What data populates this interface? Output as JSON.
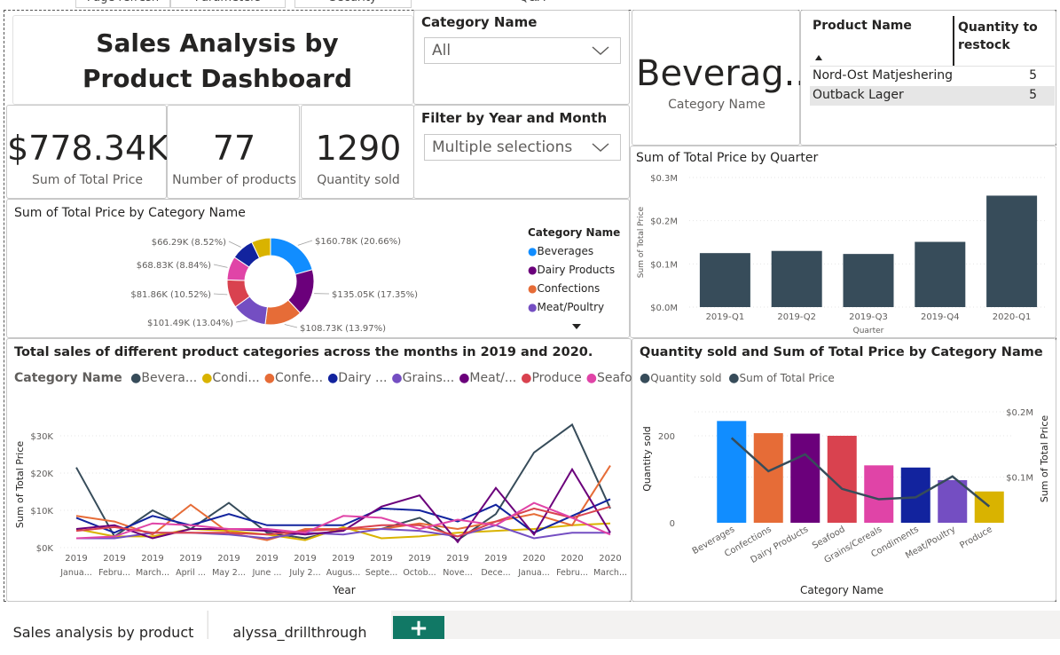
{
  "top_tabs": [
    "Page refresh",
    "Parameters",
    "Security",
    "Q&A"
  ],
  "title": "Sales Analysis by Product Dashboard",
  "cards": [
    {
      "value": "$778.34K",
      "label": "Sum of Total Price"
    },
    {
      "value": "77",
      "label": "Number of products"
    },
    {
      "value": "1290",
      "label": "Quantity sold"
    }
  ],
  "slicers": {
    "category": {
      "title": "Category Name",
      "value": "All"
    },
    "year_month": {
      "title": "Filter by Year and Month",
      "value": "Multiple selections"
    }
  },
  "category_card": {
    "value": "Beverag...",
    "label": "Category Name"
  },
  "restock_table": {
    "headers": [
      "Product Name",
      "Quantity to restock"
    ],
    "rows": [
      {
        "name": "Nord-Ost Matjeshering",
        "qty": "5"
      },
      {
        "name": "Outback Lager",
        "qty": "5"
      }
    ]
  },
  "quarter_chart": {
    "title": "Sum of Total Price by Quarter",
    "xlabel": "Quarter",
    "ylabel": "Sum of Total Price",
    "yticks": [
      "$0.0M",
      "$0.1M",
      "$0.2M",
      "$0.3M"
    ]
  },
  "donut_chart": {
    "title": "Sum of Total Price by Category Name",
    "legend_title": "Category Name",
    "legend": [
      "Beverages",
      "Dairy Products",
      "Confections",
      "Meat/Poultry"
    ],
    "labels": [
      "$160.78K (20.66%)",
      "$135.05K (17.35%)",
      "$108.73K (13.97%)",
      "$101.49K (13.04%)",
      "$81.86K (10.52%)",
      "$68.83K (8.84%)",
      "$66.29K (8.52%)"
    ]
  },
  "line_chart": {
    "title": "Total sales of different product categories across the months in 2019 and 2020.",
    "legend_title": "Category Name",
    "legend": [
      "Bevera...",
      "Condi...",
      "Confe...",
      "Dairy ...",
      "Grains...",
      "Meat/...",
      "Produce",
      "Seafood"
    ],
    "xlabel": "Year",
    "ylabel": "Sum of Total Price",
    "yticks": [
      "$0K",
      "$10K",
      "$20K",
      "$30K"
    ],
    "xticks_year": [
      "2019",
      "2019",
      "2019",
      "2019",
      "2019",
      "2019",
      "2019",
      "2019",
      "2019",
      "2019",
      "2019",
      "2019",
      "2020",
      "2020",
      "2020"
    ],
    "xticks_month": [
      "Janua...",
      "Febru...",
      "March...",
      "April ...",
      "May 2...",
      "June ...",
      "July 2...",
      "Augus...",
      "Septe...",
      "Octob...",
      "Nove...",
      "Dece...",
      "Janua...",
      "Febru...",
      "March..."
    ]
  },
  "combo_chart": {
    "title": "Quantity sold and Sum of Total Price by Category Name",
    "legend": [
      "Quantity sold",
      "Sum of Total Price"
    ],
    "xlabel": "Category Name",
    "ylabel_left": "Quantity sold",
    "ylabel_right": "Sum of Total Price",
    "yticks_left": [
      "0",
      "200"
    ],
    "yticks_right": [
      "$0.1M",
      "$0.2M"
    ]
  },
  "bottom_tabs": [
    "Sales analysis by product",
    "alyssa_drillthrough"
  ],
  "add_tab": "+",
  "chart_data": [
    {
      "type": "bar",
      "title": "Sum of Total Price by Quarter",
      "categories": [
        "2019-Q1",
        "2019-Q2",
        "2019-Q3",
        "2019-Q4",
        "2020-Q1"
      ],
      "values": [
        0.125,
        0.13,
        0.123,
        0.151,
        0.258
      ],
      "ylim": [
        0,
        0.3
      ],
      "color": "#374c5a",
      "xlabel": "Quarter",
      "ylabel": "Sum of Total Price"
    },
    {
      "type": "pie",
      "title": "Sum of Total Price by Category Name",
      "categories": [
        "Beverages",
        "Dairy Products",
        "Confections",
        "Meat/Poultry",
        "Seafood",
        "Condiments",
        "Grains/Cereals",
        "Produce"
      ],
      "values": [
        160.78,
        135.05,
        108.73,
        101.49,
        81.86,
        68.83,
        66.29,
        55.31
      ],
      "colors": [
        "#118dff",
        "#6b007b",
        "#e66c37",
        "#744ec2",
        "#d9424f",
        "#e044a7",
        "#12239e",
        "#d9b300"
      ]
    },
    {
      "type": "line",
      "title": "Total sales of different product categories across the months in 2019 and 2020.",
      "x": [
        "2019 January",
        "2019 February",
        "2019 March",
        "2019 April",
        "2019 May",
        "2019 June",
        "2019 July",
        "2019 August",
        "2019 September",
        "2019 October",
        "2019 November",
        "2019 December",
        "2020 January",
        "2020 February",
        "2020 March"
      ],
      "ylim": [
        0,
        35
      ],
      "series": [
        {
          "name": "Beverages",
          "color": "#374c5a",
          "values": [
            21.5,
            3,
            10,
            5,
            12,
            4,
            2.5,
            5,
            5,
            8,
            2,
            9,
            25.5,
            33,
            10.5
          ]
        },
        {
          "name": "Condiments",
          "color": "#d9b300",
          "values": [
            5,
            3,
            3,
            5,
            4.5,
            3.5,
            2,
            5.5,
            2.5,
            3,
            4,
            4.5,
            5,
            6,
            6.5
          ]
        },
        {
          "name": "Confections",
          "color": "#e66c37",
          "values": [
            8.5,
            7,
            3.5,
            11.5,
            4,
            2,
            5,
            5,
            5,
            6.5,
            5,
            7,
            9,
            6,
            22
          ]
        },
        {
          "name": "Dairy Products",
          "color": "#12239e",
          "values": [
            8,
            4,
            8.5,
            6,
            9,
            6,
            6,
            6,
            10.5,
            10,
            7,
            11.5,
            4,
            8.5,
            13
          ]
        },
        {
          "name": "Grains/Cereals",
          "color": "#744ec2",
          "values": [
            2.5,
            2.5,
            4,
            4,
            3.5,
            2.5,
            4,
            3.5,
            5,
            4.5,
            3,
            6,
            2.5,
            4,
            4
          ]
        },
        {
          "name": "Meat/Poultry",
          "color": "#6b007b",
          "values": [
            5,
            6,
            2.5,
            5,
            5,
            4.5,
            3.5,
            4.5,
            11,
            14,
            1.5,
            16,
            3.5,
            21,
            4
          ]
        },
        {
          "name": "Produce",
          "color": "#d9424f",
          "values": [
            4.5,
            5.5,
            4,
            4,
            4,
            3.5,
            4.5,
            5,
            6,
            6,
            3,
            7,
            10.5,
            8,
            11
          ]
        },
        {
          "name": "Seafood",
          "color": "#e044a7",
          "values": [
            2.5,
            3,
            6.5,
            6,
            5,
            5,
            4,
            8.5,
            8,
            5,
            7.5,
            6,
            12,
            8,
            3.5
          ]
        }
      ],
      "xlabel": "Year",
      "ylabel": "Sum of Total Price"
    },
    {
      "type": "bar",
      "title": "Quantity sold and Sum of Total Price by Category Name",
      "categories": [
        "Beverages",
        "Confections",
        "Dairy Products",
        "Seafood",
        "Grains/Cereals",
        "Condiments",
        "Meat/Poultry",
        "Produce"
      ],
      "colors": [
        "#118dff",
        "#e66c37",
        "#6b007b",
        "#d9424f",
        "#e044a7",
        "#12239e",
        "#744ec2",
        "#d9b300"
      ],
      "series": [
        {
          "name": "Quantity sold",
          "values": [
            234,
            206,
            205,
            200,
            132,
            127,
            98,
            72
          ]
        },
        {
          "name": "Sum of Total Price",
          "values": [
            0.16,
            0.109,
            0.135,
            0.082,
            0.066,
            0.069,
            0.101,
            0.055
          ],
          "line_color": "#374c5a"
        }
      ],
      "ylim_left": [
        0,
        300
      ],
      "ylim_right": [
        0.03,
        0.23
      ],
      "xlabel": "Category Name"
    }
  ]
}
